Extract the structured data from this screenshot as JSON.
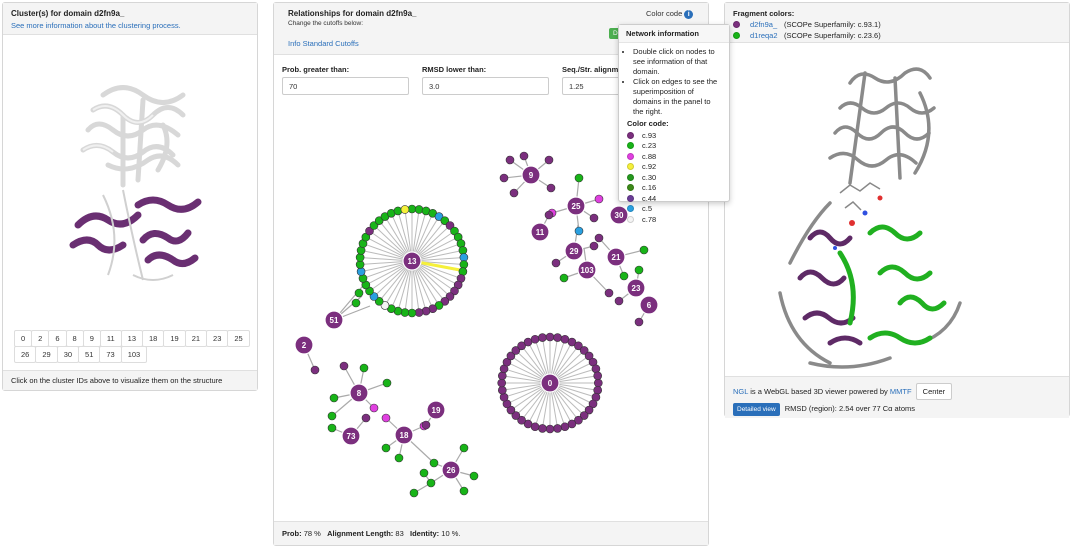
{
  "cluster_panel": {
    "title": "Cluster(s) for domain d2fn9a_",
    "info_link": "See more information about the clustering process.",
    "cluster_ids": [
      "0",
      "2",
      "6",
      "8",
      "9",
      "11",
      "13",
      "18",
      "19",
      "21",
      "23",
      "25",
      "26",
      "29",
      "30",
      "51",
      "73",
      "103"
    ],
    "footer": "Click on the cluster IDs above to visualize them on the structure"
  },
  "relationships_panel": {
    "title": "Relationships for domain d2fn9a_",
    "subtitle": "Change the cutoffs below:",
    "info_link": "Info Standard Cutoffs",
    "color_code_label": "Color code",
    "default_button": "Defa",
    "cutoffs": [
      {
        "label": "Prob. greater than:",
        "value": "70"
      },
      {
        "label": "RMSD lower than:",
        "value": "3.0"
      },
      {
        "label": "Seq./Str. alignme",
        "value": "1.25"
      }
    ],
    "footer": {
      "prob_label": "Prob:",
      "prob_value": "78 %",
      "align_label": "Alignment Length:",
      "align_value": "83",
      "identity_label": "Identity:",
      "identity_value": "10 %."
    },
    "node_labels": [
      "13",
      "51",
      "2",
      "0",
      "9",
      "25",
      "30",
      "11",
      "29",
      "21",
      "103",
      "23",
      "6",
      "8",
      "19",
      "73",
      "18",
      "26"
    ]
  },
  "network_popover": {
    "title": "Network information",
    "items": [
      "Double click on nodes to see information of that domain.",
      "Click on edges to see the superimposition of domains in the panel to the right."
    ],
    "color_code_title": "Color code:",
    "legend": [
      {
        "label": "c.93",
        "color": "#7b2f7e"
      },
      {
        "label": "c.23",
        "color": "#18b418"
      },
      {
        "label": "c.88",
        "color": "#e040e0"
      },
      {
        "label": "c.92",
        "color": "#f5f03a"
      },
      {
        "label": "c.30",
        "color": "#25981e"
      },
      {
        "label": "c.16",
        "color": "#3c8a18"
      },
      {
        "label": "c.44",
        "color": "#6a3d96"
      },
      {
        "label": "c.5",
        "color": "#2aa0e0"
      },
      {
        "label": "c.78",
        "color": "#f4f4f4"
      }
    ]
  },
  "fragment_panel": {
    "title": "Fragment colors:",
    "fragments": [
      {
        "name": "d2fn9a_",
        "desc": "(SCOPe Superfamily: c.93.1)",
        "color": "#7b2f7e"
      },
      {
        "name": "d1reqa2",
        "desc": "(SCOPe Superfamily: c.23.6)",
        "color": "#18b418"
      }
    ],
    "ngl_link": "NGL",
    "viewer_text": " is a WebGL based 3D viewer powered by ",
    "mmtf_link": "MMTF",
    "center_button": "Center",
    "detailed_button": "Detailed view",
    "rmsd_text": "RMSD (region): 2.54 over 77 Cα atoms"
  }
}
